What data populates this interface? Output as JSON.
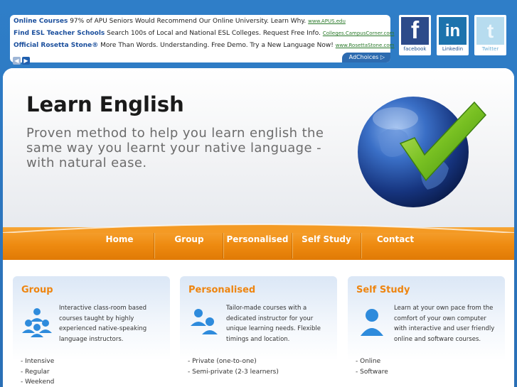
{
  "ads": {
    "items": [
      {
        "title": "Online Courses",
        "text": "97% of APU Seniors Would Recommend Our Online University. Learn Why.",
        "url": "www.APUS.edu"
      },
      {
        "title": "Find ESL Teacher Schools",
        "text": "Search 100s of Local and National ESL Colleges. Request Free Info.",
        "url": "Colleges.CampusCorner.com"
      },
      {
        "title": "Official Rosetta Stone®",
        "text": "More Than Words. Understanding. Free Demo. Try a New Language Now!",
        "url": "www.RosettaStone.com"
      }
    ],
    "prev_glyph": "◀",
    "next_glyph": "▶",
    "adchoices": "AdChoices ▷"
  },
  "social": {
    "facebook": {
      "glyph": "f",
      "label": "facebook"
    },
    "linkedin": {
      "glyph": "in",
      "label": "Linkedin"
    },
    "twitter": {
      "glyph": "t",
      "label": "Twitter"
    }
  },
  "hero": {
    "title": "Learn English",
    "subtitle": "Proven method to help you learn english the same way you learnt your native language - with natural ease."
  },
  "nav": {
    "items": [
      "Home",
      "Group",
      "Personalised",
      "Self Study",
      "Contact"
    ]
  },
  "cards": [
    {
      "title": "Group",
      "desc": "Interactive class-room based courses taught by highly experienced native-speaking language instructors.",
      "list": [
        "- Intensive",
        "- Regular",
        "- Weekend"
      ]
    },
    {
      "title": "Personalised",
      "desc": "Tailor-made courses with a dedicated instructor for your unique learning needs. Flexible timings and location.",
      "list": [
        "- Private (one-to-one)",
        "- Semi-private (2-3 learners)"
      ]
    },
    {
      "title": "Self Study",
      "desc": "Learn at your own pace from the comfort of your own computer with interactive and user friendly online and software courses.",
      "list": [
        "- Online",
        "- Software"
      ]
    }
  ],
  "colors": {
    "background": "#2f7ec8",
    "accent_orange": "#ee8a10",
    "card_title": "#ee8510",
    "ad_title": "#1a4e9c",
    "ad_url": "#2b7a2b"
  },
  "icons": {
    "hero": "globe-checkmark-icon",
    "group": "people-group-icon",
    "personalised": "two-people-icon",
    "self_study": "single-person-icon"
  }
}
